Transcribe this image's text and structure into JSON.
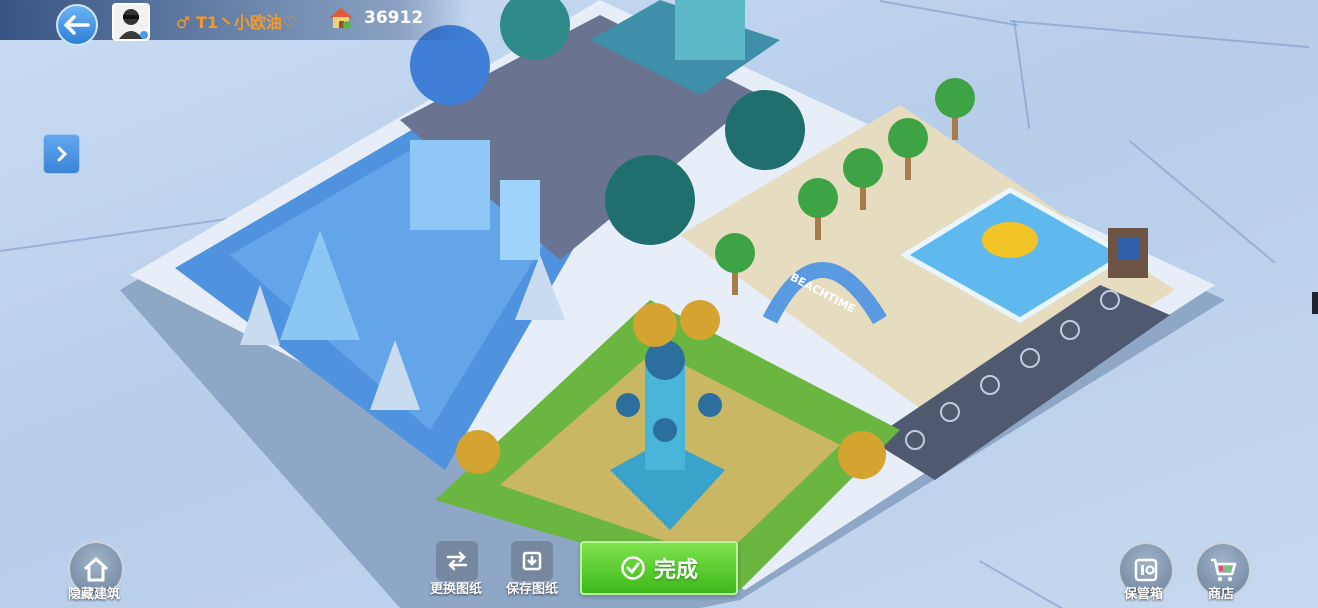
{
  "top_bar": {
    "player_name": "♂ T1丶小欧油♡",
    "currency_value": "36912"
  },
  "board": {
    "sign_text": "BEACHTIME"
  },
  "bottom_left": {
    "hide_buildings_label": "隐藏建筑"
  },
  "bottom_center": {
    "change_blueprint_label": "更换图纸",
    "save_blueprint_label": "保存图纸",
    "done_label": "完成"
  },
  "bottom_right": {
    "storage_label": "保管箱",
    "shop_label": "商店"
  },
  "colors": {
    "accent_blue": "#2f7fd6",
    "done_green": "#3cb81a",
    "name_orange": "#f59a2a"
  }
}
